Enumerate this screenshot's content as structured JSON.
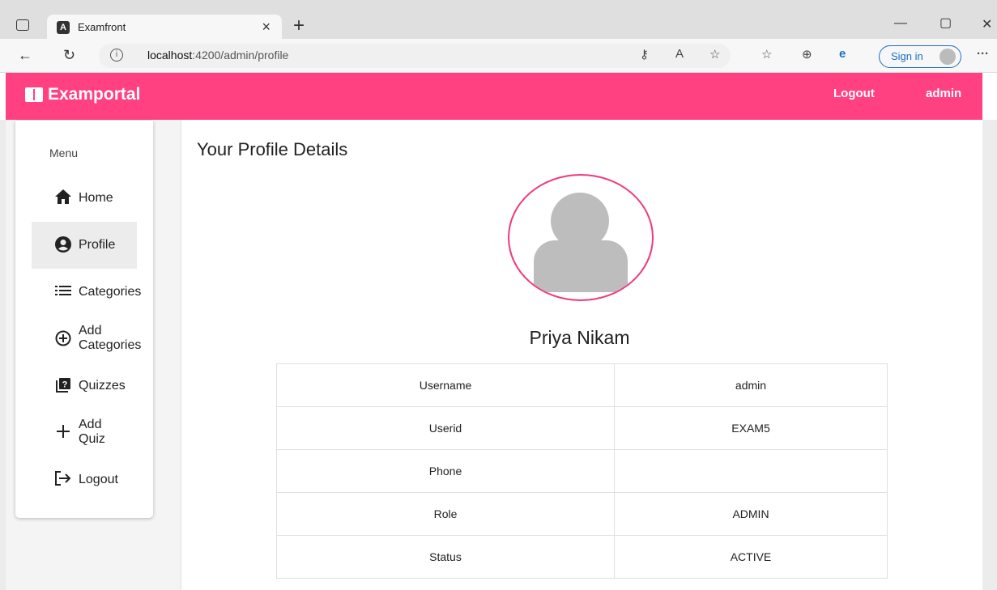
{
  "browser": {
    "tab_title": "Examfront",
    "tab_favicon": "A",
    "url_host": "localhost",
    "url_path": ":4200/admin/profile",
    "signin_label": "Sign in"
  },
  "navbar": {
    "brand": "Examportal",
    "links": [
      "Logout",
      "admin"
    ],
    "color": "#ff4081"
  },
  "sidebar": {
    "heading": "Menu",
    "items": [
      {
        "label": "Home",
        "icon": "home-icon"
      },
      {
        "label": "Profile",
        "icon": "account-circle-icon",
        "active": true
      },
      {
        "label": "Categories",
        "icon": "list-icon"
      },
      {
        "label": "Add Categories",
        "line1": "Add",
        "line2": "Categories",
        "icon": "add-circle-icon"
      },
      {
        "label": "Quizzes",
        "icon": "quiz-icon"
      },
      {
        "label": "Add Quiz",
        "line1": "Add",
        "line2": "Quiz",
        "icon": "plus-icon"
      },
      {
        "label": "Logout",
        "icon": "logout-icon"
      }
    ]
  },
  "profile": {
    "heading": "Your Profile Details",
    "name": "Priya Nikam",
    "rows": [
      {
        "key": "Username",
        "value": "admin"
      },
      {
        "key": "Userid",
        "value": "EXAM5"
      },
      {
        "key": "Phone",
        "value": ""
      },
      {
        "key": "Role",
        "value": "ADMIN"
      },
      {
        "key": "Status",
        "value": "ACTIVE"
      }
    ]
  }
}
